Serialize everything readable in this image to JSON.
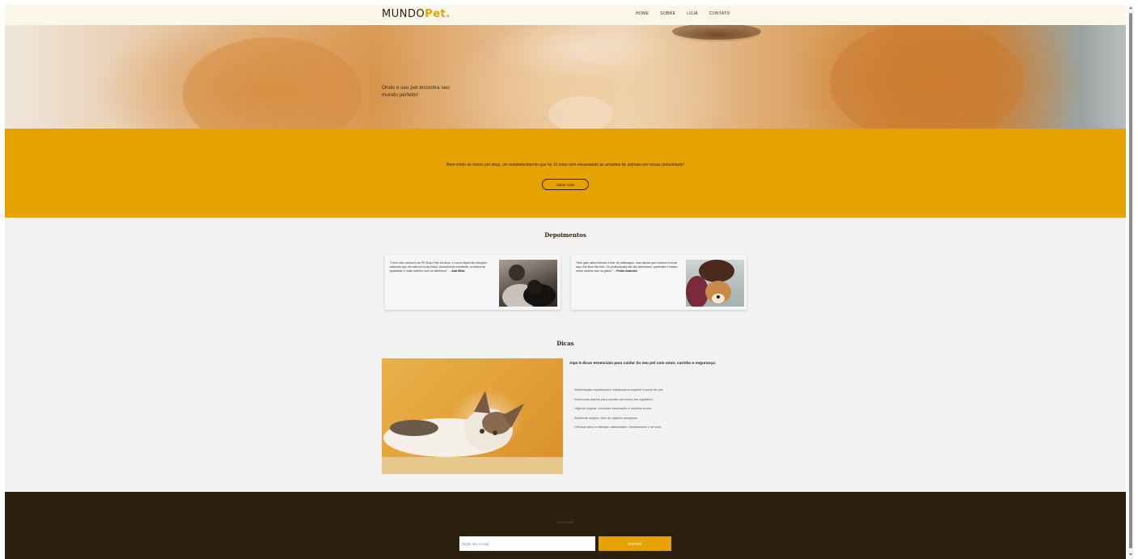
{
  "header": {
    "logo_main": "MUNDO",
    "logo_accent": "Pet.",
    "nav": [
      "HOME",
      "SOBRE",
      "LOJA",
      "CONTATO"
    ]
  },
  "hero": {
    "tagline": "Onde o seu pet encontra seu mundo perfeito!"
  },
  "welcome": {
    "text": "Bem-vindo ao nosso pet shop, um estabelecimento que há 10 anos vem encantando as amantes de animais em nossa comunidade!",
    "button": "Saiba mais"
  },
  "testimonials": {
    "title": "Depoimentos",
    "items": [
      {
        "quote": "\"Levei meu cachorro ao Pit Shop Feliz há anos, e nunca fiquei tão tranquilo sabendo que ele está em boas mãos. Atendimento excelente, produtos de qualidade e muito carinho com os bichinhos.\" –",
        "author": "Ana Silva"
      },
      {
        "quote": "\"Meu gato adora brincar e tirar de petiscagos, mas depois que comecei a levar aqui, ele ficou tão feliz. Os profissionais são tão atenciosos, pacientes e tratam muito carinho com os gatos.\" –",
        "author": "Pedro Antunes"
      }
    ]
  },
  "tips": {
    "title": "Dicas",
    "heading": "Aqui 5 dicas essenciais para cuidar do seu pet com amor, carinho e segurança:",
    "items": [
      "Alimentação equilibrada e adequada à espécie e porte do pet.",
      "Exercícios diários para manter seu bicho em equilíbrio.",
      "Higiene regular, incluindo escovação e cuidado bucal.",
      "Ambiente seguro, livre de objetos perigosos.",
      "Ofereça amor e atenção diariamente, fortalecendo o vínculo."
    ]
  },
  "footer": {
    "newsletter_label": "Newsletter",
    "email_placeholder": "Digite seu e-mail",
    "button": "ENVIAR"
  },
  "colors": {
    "accent": "#e6a200",
    "header_bg": "#fbf6ea",
    "footer_bg": "#2b1f0f",
    "text_dark": "#2f1f10"
  }
}
